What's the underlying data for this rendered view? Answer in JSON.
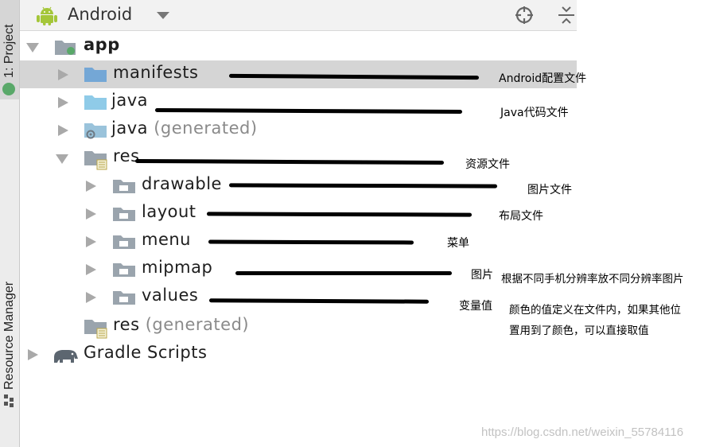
{
  "side_tabs": {
    "project": "1: Project",
    "resource_manager": "Resource Manager"
  },
  "header": {
    "title": "Android"
  },
  "tree": {
    "app": "app",
    "manifests": "manifests",
    "java": "java",
    "java_generated": {
      "name": "java",
      "suffix": "(generated)"
    },
    "res": "res",
    "drawable": "drawable",
    "layout": "layout",
    "menu": "menu",
    "mipmap": "mipmap",
    "values": "values",
    "res_generated": {
      "name": "res",
      "suffix": "(generated)"
    },
    "gradle_scripts": "Gradle Scripts"
  },
  "notes": {
    "manifests": "Android配置文件",
    "java": "Java代码文件",
    "res": "资源文件",
    "drawable": "图片文件",
    "layout": "布局文件",
    "menu": "菜单",
    "mipmap": "图片",
    "mipmap_extra": "根据不同手机分辨率放不同分辨率图片",
    "values": "变量值",
    "values_extra_line1": "颜色的值定义在文件内，如果其他位",
    "values_extra_line2": "置用到了颜色，可以直接取值"
  },
  "watermark": "https://blog.csdn.net/weixin_55784116",
  "colors": {
    "folder_blue": "#74a7d6",
    "folder_gray": "#9aa4ad",
    "android_green": "#a4c639",
    "selection": "#d5d5d5"
  }
}
